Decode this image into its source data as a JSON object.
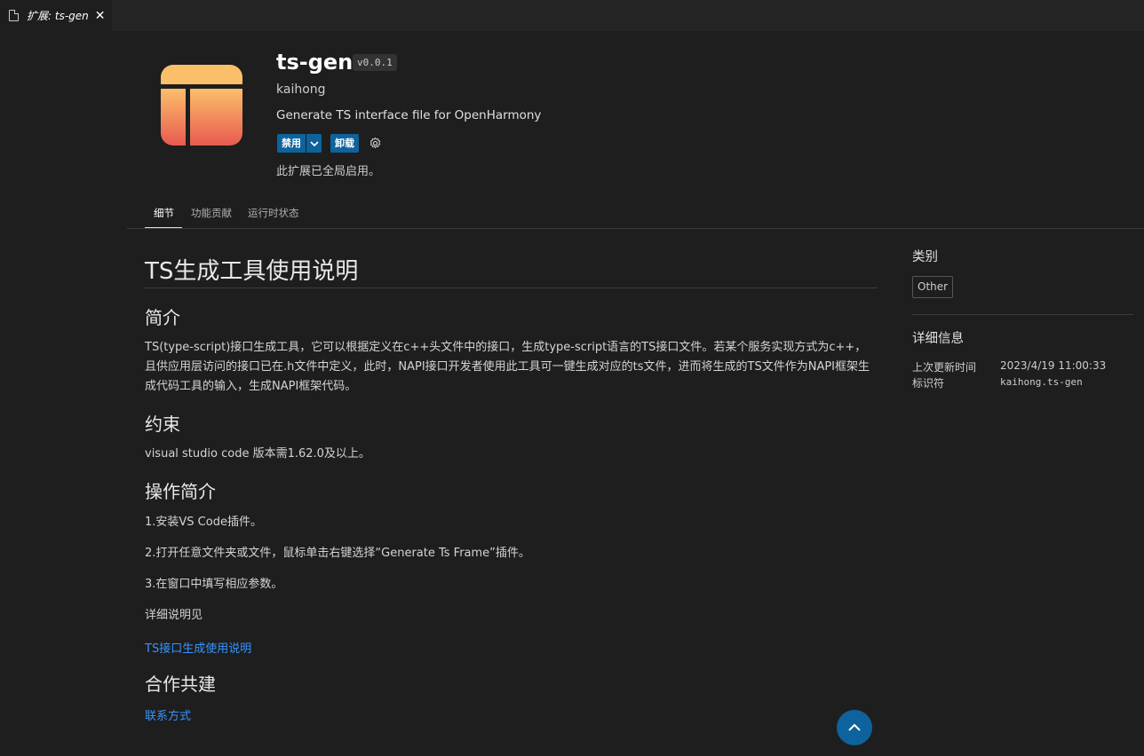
{
  "tab": {
    "label": "扩展: ts-gen",
    "close": "✕"
  },
  "extension": {
    "name": "ts-gen",
    "version": "v0.0.1",
    "publisher": "kaihong",
    "description": "Generate TS interface file for OpenHarmony",
    "disable_label": "禁用",
    "uninstall_label": "卸载",
    "status": "此扩展已全局启用。",
    "icon_colors": {
      "top": "#fbbf6a",
      "bottom": "#e85a50"
    }
  },
  "nav_tabs": [
    "细节",
    "功能贡献",
    "运行时状态"
  ],
  "readme": {
    "title": "TS生成工具使用说明",
    "sections": [
      {
        "heading": "简介",
        "text": "TS(type-script)接口生成工具，它可以根据定义在c++头文件中的接口，生成type-script语言的TS接口文件。若某个服务实现方式为c++，且供应用层访问的接口已在.h文件中定义，此时，NAPI接口开发者使用此工具可一键生成对应的ts文件，进而将生成的TS文件作为NAPI框架生成代码工具的输入，生成NAPI框架代码。"
      },
      {
        "heading": "约束",
        "text": "visual studio code 版本需1.62.0及以上。"
      },
      {
        "heading": "操作简介",
        "steps": [
          "1.安装VS Code插件。",
          "2.打开任意文件夹或文件，鼠标单击右键选择“Generate Ts Frame”插件。",
          "3.在窗口中填写相应参数。",
          "详细说明见"
        ],
        "link": "TS接口生成使用说明"
      },
      {
        "heading": "合作共建",
        "link": "联系方式"
      }
    ]
  },
  "sidebar": {
    "categories_heading": "类别",
    "category": "Other",
    "details_heading": "详细信息",
    "last_updated_label": "上次更新时间",
    "last_updated_value": "2023/4/19 11:00:33",
    "identifier_label": "标识符",
    "identifier_value": "kaihong.ts-gen"
  },
  "colors": {
    "accent": "#0e639c",
    "link": "#3794ff",
    "background": "#1e1e1e"
  }
}
